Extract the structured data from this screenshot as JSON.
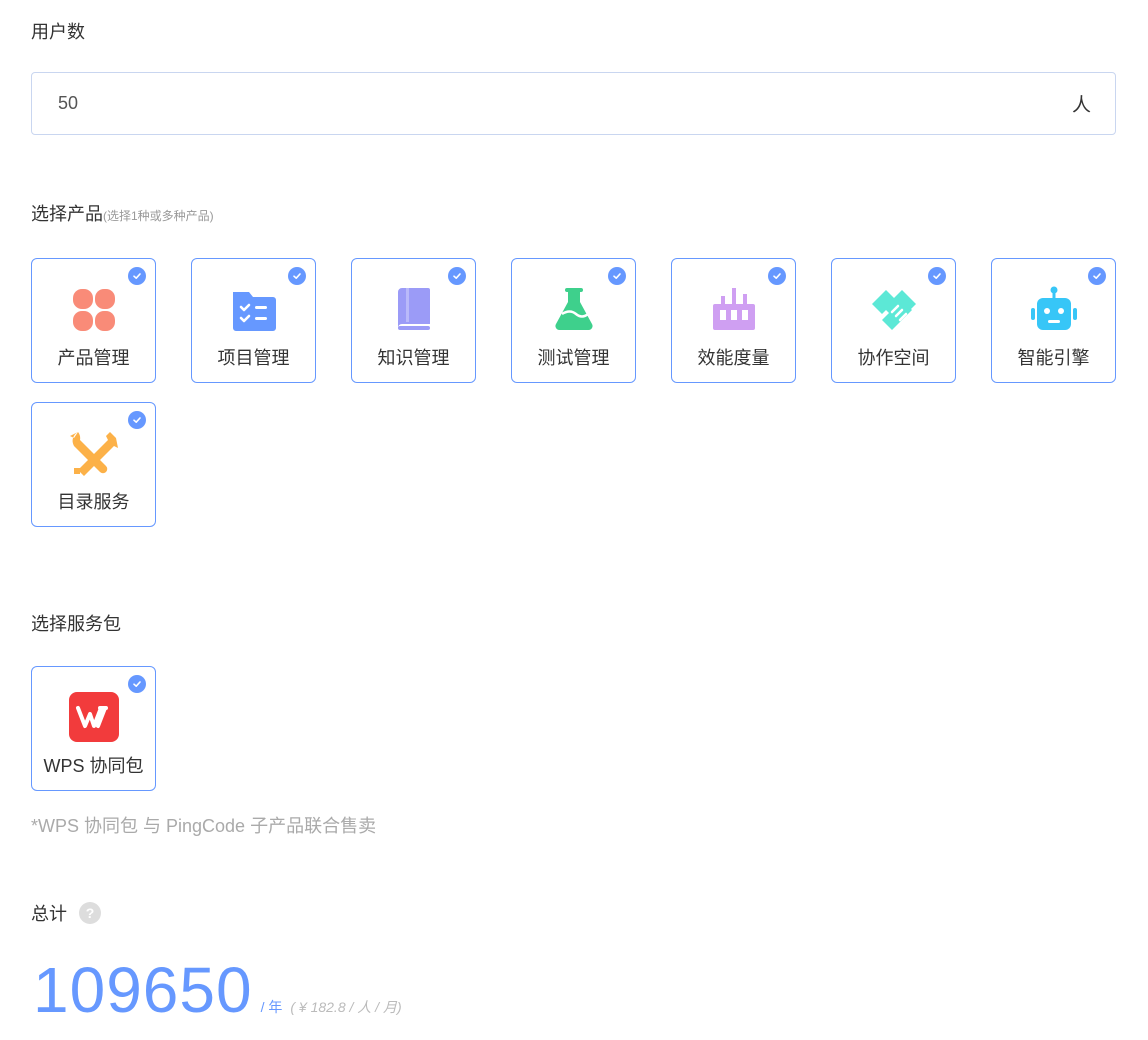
{
  "users": {
    "label": "用户数",
    "value": "50",
    "unit": "人"
  },
  "products": {
    "label": "选择产品",
    "hint": "(选择1种或多种产品)",
    "items": [
      {
        "label": "产品管理",
        "icon": "clover-icon",
        "color": "#f98b78",
        "selected": true
      },
      {
        "label": "项目管理",
        "icon": "task-folder-icon",
        "color": "#6698ff",
        "selected": true
      },
      {
        "label": "知识管理",
        "icon": "book-icon",
        "color": "#9b9bf7",
        "selected": true
      },
      {
        "label": "测试管理",
        "icon": "flask-icon",
        "color": "#3ed08c",
        "selected": true
      },
      {
        "label": "效能度量",
        "icon": "metrics-icon",
        "color": "#cf9ff2",
        "selected": true
      },
      {
        "label": "协作空间",
        "icon": "handshake-icon",
        "color": "#5ce8d6",
        "selected": true
      },
      {
        "label": "智能引擎",
        "icon": "robot-icon",
        "color": "#37c6f7",
        "selected": true
      },
      {
        "label": "目录服务",
        "icon": "tools-icon",
        "color": "#fcb148",
        "selected": true
      }
    ]
  },
  "packages": {
    "label": "选择服务包",
    "items": [
      {
        "label": "WPS 协同包",
        "icon": "wps-icon",
        "color": "#f23b3c",
        "selected": true
      }
    ],
    "note": "*WPS 协同包 与 PingCode 子产品联合售卖"
  },
  "total": {
    "label": "总计",
    "help_icon": "help-icon",
    "amount": "109650",
    "per": "/ 年",
    "detail": "( ¥ 182.8 / 人 / 月)"
  },
  "accent_color": "#6698ff"
}
